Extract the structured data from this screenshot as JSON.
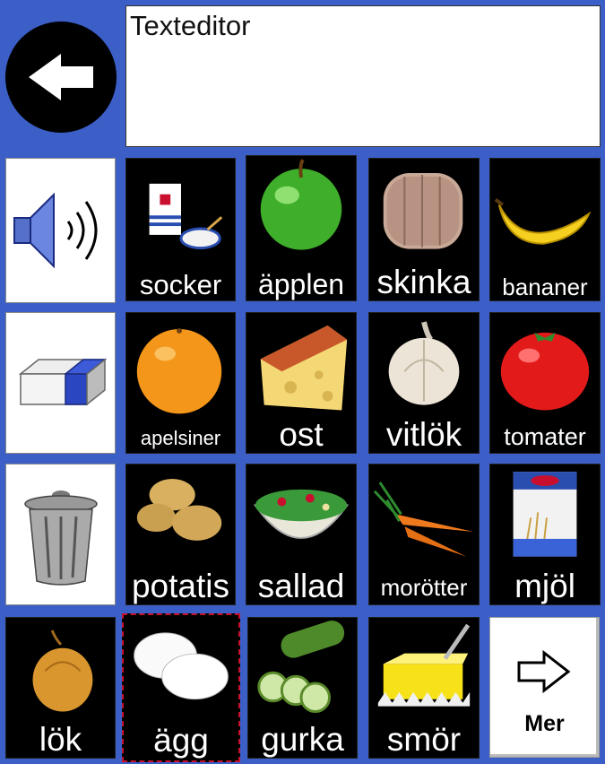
{
  "editor": {
    "text": "Texteditor"
  },
  "icons": {
    "back": "arrow-left-icon",
    "speak": "speaker-icon",
    "erase": "eraser-icon",
    "clear": "trash-can-icon",
    "more": "arrow-right-icon"
  },
  "tiles": [
    {
      "label": "socker"
    },
    {
      "label": "äpplen"
    },
    {
      "label": "skinka"
    },
    {
      "label": "bananer"
    },
    {
      "label": "apelsiner"
    },
    {
      "label": "ost"
    },
    {
      "label": "vitlök"
    },
    {
      "label": "tomater"
    },
    {
      "label": "potatis"
    },
    {
      "label": "sallad"
    },
    {
      "label": "morötter"
    },
    {
      "label": "mjöl"
    },
    {
      "label": "lök"
    },
    {
      "label": "ägg"
    },
    {
      "label": "gurka"
    },
    {
      "label": "smör"
    }
  ],
  "more": {
    "label": "Mer"
  },
  "colors": {
    "background": "#3b5fc7",
    "tile": "#000000",
    "selection": "#c8102e"
  }
}
